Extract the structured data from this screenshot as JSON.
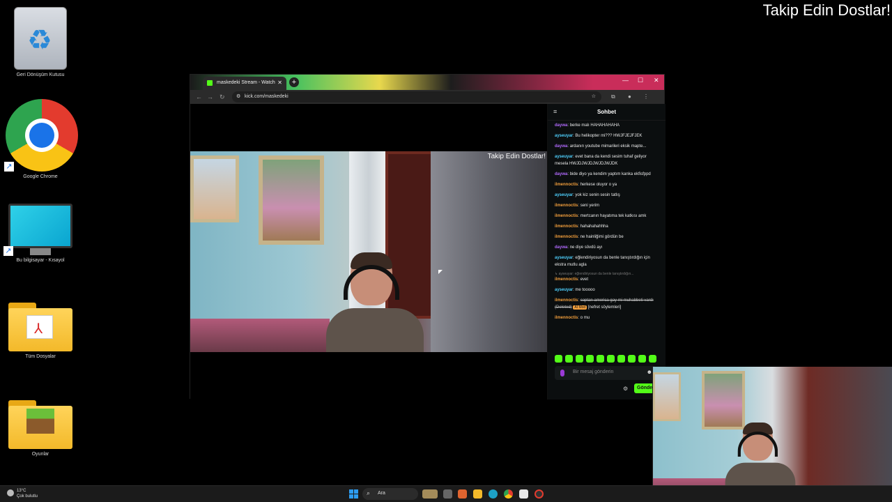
{
  "overlay": {
    "title": "Takip Edin Dostlar!"
  },
  "desktop": {
    "icons": [
      {
        "label": "Geri Dönüşüm Kutusu"
      },
      {
        "label": "Google Chrome"
      },
      {
        "label": "Bu bilgisayar - Kısayol"
      },
      {
        "label": "Tüm Dosyalar"
      },
      {
        "label": "Oyunlar"
      }
    ]
  },
  "browser": {
    "tab_title": "maskedeki Stream - Watch",
    "url": "kick.com/maskedeki",
    "new_tab": "+",
    "close_tab": "✕",
    "window_controls": {
      "minimize": "—",
      "maximize": "☐",
      "close": "✕"
    }
  },
  "player": {
    "caption": "Takip Edin Dostlar!"
  },
  "chat": {
    "header": "Sohbet",
    "messages": [
      {
        "user": "daywa",
        "color": "#b36bff",
        "text": "berke malı HAHAHAHAHA"
      },
      {
        "user": "ayseuyar",
        "color": "#4fd1ff",
        "text": "Bu helikopter mi??? HWJFJEJFJEK"
      },
      {
        "user": "daywa",
        "color": "#b36bff",
        "text": "ardanın youtube mimarileri eksik mapte..."
      },
      {
        "user": "ayseuyar",
        "color": "#4fd1ff",
        "text": "evet bana da kendi sesim tuhaf geliyor mesela HWJDJWJDJWJDJWJDK"
      },
      {
        "user": "daywa",
        "color": "#b36bff",
        "text": "bide diyo ya kendim yaptım kanka ekfisfppd"
      },
      {
        "user": "ilmennoctis",
        "color": "#f29f3d",
        "text": "herkese oluyor o ya"
      },
      {
        "user": "ayseuyar",
        "color": "#4fd1ff",
        "text": "yok kiz senin sesin tatlış"
      },
      {
        "user": "ilmennoctis",
        "color": "#f29f3d",
        "text": "seni yerim"
      },
      {
        "user": "ilmennoctis",
        "color": "#f29f3d",
        "text": "mertcanın hayatıma tek katkısı amk"
      },
      {
        "user": "ilmennoctis",
        "color": "#f29f3d",
        "text": "hahahahahhha"
      },
      {
        "user": "ilmennoctis",
        "color": "#f29f3d",
        "text": "ne hainliğimi gördün be"
      },
      {
        "user": "daywa",
        "color": "#b36bff",
        "text": "ne diye sövdü ayı"
      },
      {
        "user": "ayseuyar",
        "color": "#4fd1ff",
        "text": "eğlendiriyosun da benle tanıştırdığın için ekstra mutlu agla"
      },
      {
        "user": "ilmennoctis",
        "color": "#f29f3d",
        "text": "evet",
        "reply": "↳ ayseuyar: eğlendiriyosun da benle tanıştırdığın..."
      },
      {
        "user": "ayseuyar",
        "color": "#4fd1ff",
        "text": "me tooooo"
      },
      {
        "user": "ilmennoctis",
        "color": "#f29f3d",
        "text": "captan america gay mi muhabbeti vardı (Deleted)",
        "deleted": true,
        "badge": "AI Mod",
        "note": "[nefret söylemleri]"
      },
      {
        "user": "ilmennoctis",
        "color": "#f29f3d",
        "text": "o mu"
      }
    ],
    "input_placeholder": "Bir mesaj gönderin",
    "send_label": "Gönder"
  },
  "taskbar": {
    "weather_temp": "13°C",
    "weather_desc": "Çok bulutlu",
    "search_label": "Ara"
  }
}
